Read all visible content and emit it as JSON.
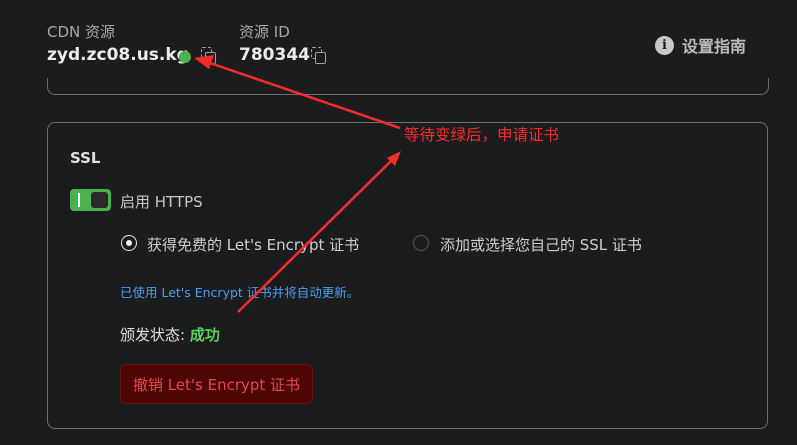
{
  "header": {
    "cdn_label": "CDN 资源",
    "cdn_value": "zyd.zc08.us.kg",
    "resource_id_label": "资源 ID",
    "resource_id_value": "780344",
    "guide_label": "设置指南",
    "status_color": "#4caf50"
  },
  "ssl": {
    "title": "SSL",
    "https_label": "启用 HTTPS",
    "https_enabled": true,
    "option_letsencrypt": "获得免费的 Let's Encrypt 证书",
    "option_custom": "添加或选择您自己的 SSL 证书",
    "selected_option": "letsencrypt",
    "auto_renew_note": "已使用 Let's Encrypt 证书并将自动更新。",
    "issue_status_label": "颁发状态:",
    "issue_status_value": "成功",
    "revoke_button": "撤销 Let's Encrypt 证书"
  },
  "annotation": {
    "text": "等待变绿后，申请证书",
    "color": "#ff2a2a"
  }
}
